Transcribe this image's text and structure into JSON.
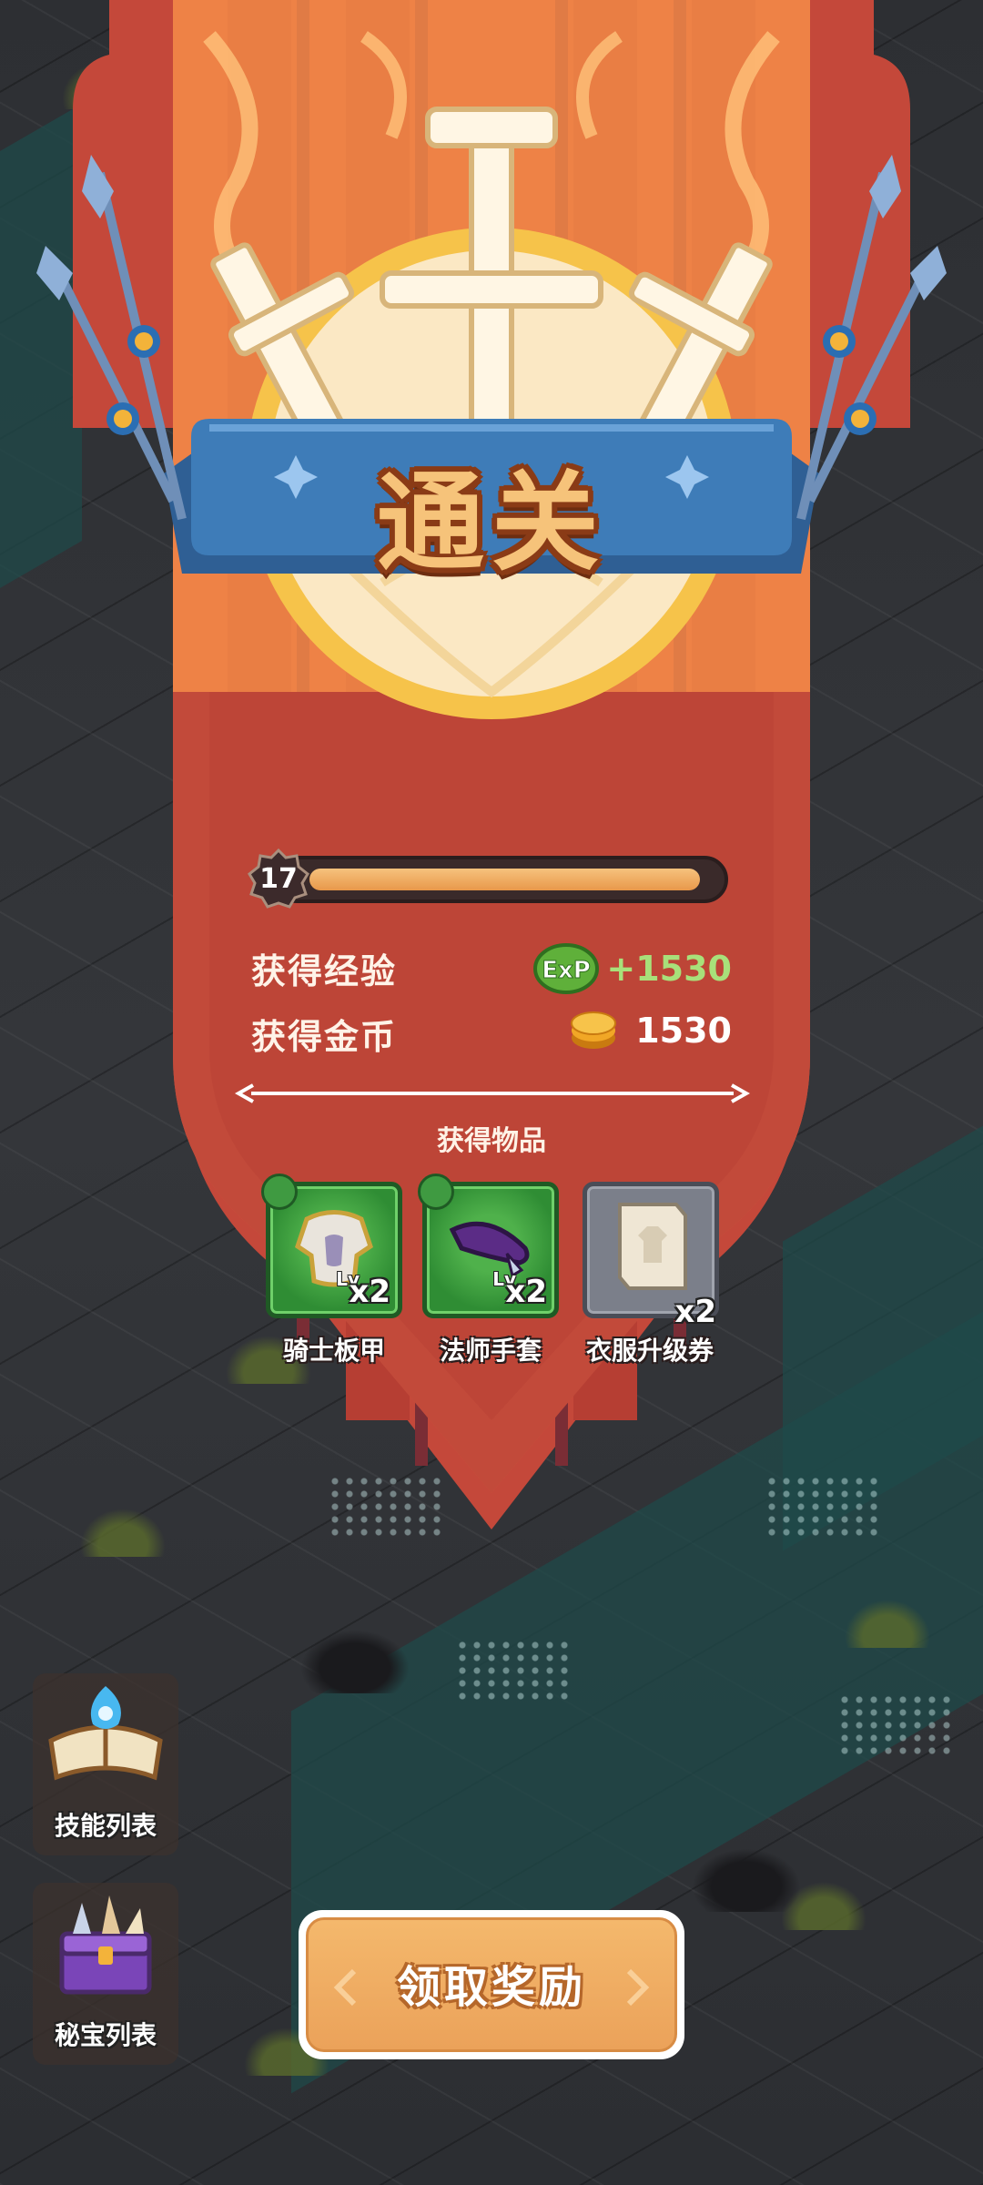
{
  "banner": {
    "title": "通关"
  },
  "level": {
    "number": "17",
    "progress": 0.97
  },
  "rewards": {
    "exp_label": "获得经验",
    "exp_icon": "exp-badge-icon",
    "exp_value": "+1530",
    "gold_label": "获得金币",
    "gold_icon": "gold-coin-icon",
    "gold_value": "1530"
  },
  "items": {
    "title": "获得物品",
    "list": [
      {
        "name": "骑士板甲",
        "icon": "knight-armor-icon",
        "count": "x2",
        "level_tag": "Lv",
        "rarity": "green"
      },
      {
        "name": "法师手套",
        "icon": "mage-glove-icon",
        "count": "x2",
        "level_tag": "Lv",
        "rarity": "green"
      },
      {
        "name": "衣服升级券",
        "icon": "clothing-upgrade-ticket-icon",
        "count": "x2",
        "rarity": "gray"
      }
    ]
  },
  "side_buttons": {
    "skills_label": "技能列表",
    "treasure_label": "秘宝列表"
  },
  "claim_button": {
    "label": "领取奖励"
  },
  "colors": {
    "exp_value": "#a8e07a",
    "gold_value": "#ffffff",
    "banner_red": "#c4483a",
    "banner_orange": "#f27a3e",
    "ribbon_blue": "#3e7cb8",
    "accent_orange": "#eba25a"
  }
}
